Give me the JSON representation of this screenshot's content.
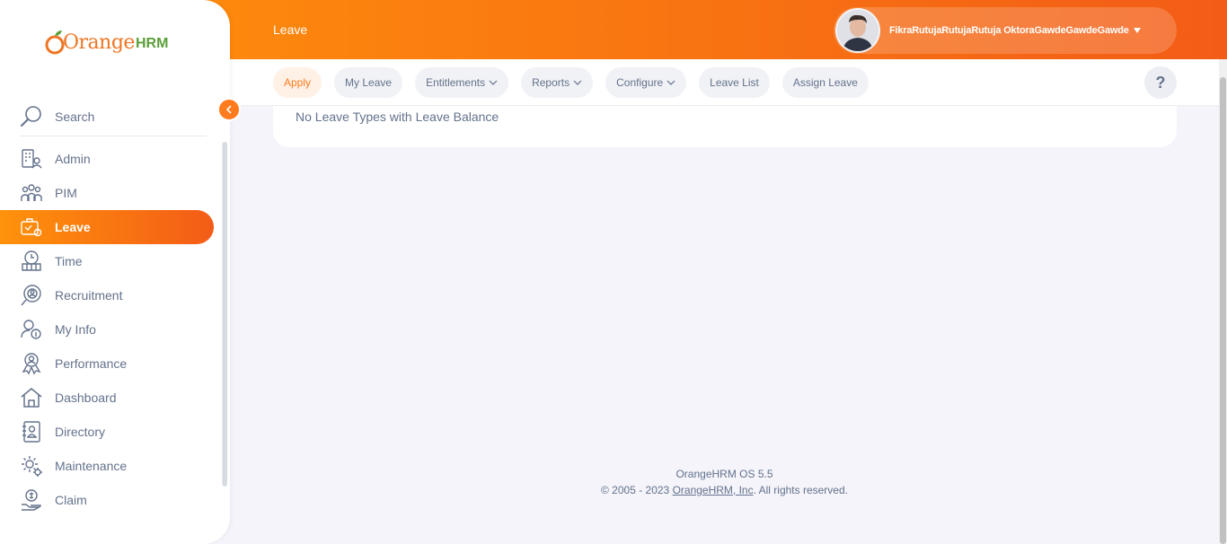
{
  "brand": {
    "name": "Orange",
    "suffix": "HRM",
    "logo_icon": "orange-logo-icon"
  },
  "header": {
    "title": "Leave",
    "user_name": "FikraRutujaRutujaRutuja OktoraGawdeGawdeGawde"
  },
  "sidebar": {
    "search_label": "Search",
    "items": [
      {
        "label": "Admin",
        "icon": "admin-icon"
      },
      {
        "label": "PIM",
        "icon": "pim-icon"
      },
      {
        "label": "Leave",
        "icon": "leave-icon",
        "active": true
      },
      {
        "label": "Time",
        "icon": "time-icon"
      },
      {
        "label": "Recruitment",
        "icon": "recruitment-icon"
      },
      {
        "label": "My Info",
        "icon": "my-info-icon"
      },
      {
        "label": "Performance",
        "icon": "performance-icon"
      },
      {
        "label": "Dashboard",
        "icon": "dashboard-icon"
      },
      {
        "label": "Directory",
        "icon": "directory-icon"
      },
      {
        "label": "Maintenance",
        "icon": "maintenance-icon"
      },
      {
        "label": "Claim",
        "icon": "claim-icon"
      }
    ]
  },
  "subnav": {
    "tabs": [
      {
        "label": "Apply",
        "active": true
      },
      {
        "label": "My Leave"
      },
      {
        "label": "Entitlements",
        "dropdown": true
      },
      {
        "label": "Reports",
        "dropdown": true
      },
      {
        "label": "Configure",
        "dropdown": true
      },
      {
        "label": "Leave List"
      },
      {
        "label": "Assign Leave"
      }
    ],
    "help_label": "?"
  },
  "main": {
    "message": "No Leave Types with Leave Balance"
  },
  "footer": {
    "version": "OrangeHRM OS 5.5",
    "copyright_prefix": "© 2005 - 2023 ",
    "company_link": "OrangeHRM, Inc",
    "copyright_suffix": ". All rights reserved."
  },
  "colors": {
    "accent": "#ff7b1d",
    "gradient_start": "#ff920b",
    "gradient_end": "#f35c17",
    "text": "#64728c"
  }
}
